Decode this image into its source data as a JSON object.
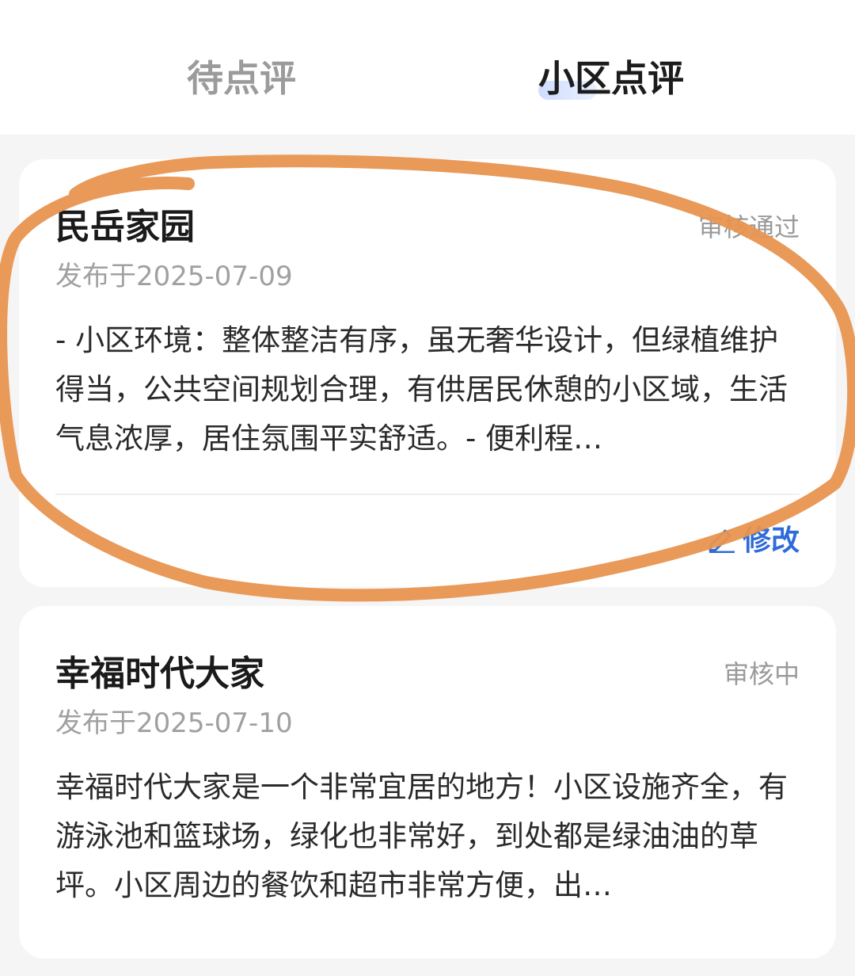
{
  "tabs": {
    "pending_label": "待点评",
    "reviews_label": "小区点评"
  },
  "cards": [
    {
      "title": "民岳家园",
      "status": "审核通过",
      "date": "发布于2025-07-09",
      "body": "- 小区环境：整体整洁有序，虽无奢华设计，但绿植维护得当，公共空间规划合理，有供居民休憩的小区域，生活气息浓厚，居住氛围平实舒适。- 便利程…",
      "edit_label": "修改"
    },
    {
      "title": "幸福时代大家",
      "status": "审核中",
      "date": "发布于2025-07-10",
      "body": "幸福时代大家是一个非常宜居的地方！小区设施齐全，有游泳池和篮球场，绿化也非常好，到处都是绿油油的草坪。小区周边的餐饮和超市非常方便，出…"
    }
  ],
  "colors": {
    "accent": "#2f6bd8",
    "annotation": "#e8944f",
    "status": "#9a9a9a"
  },
  "icons": {
    "edit": "edit-icon"
  }
}
